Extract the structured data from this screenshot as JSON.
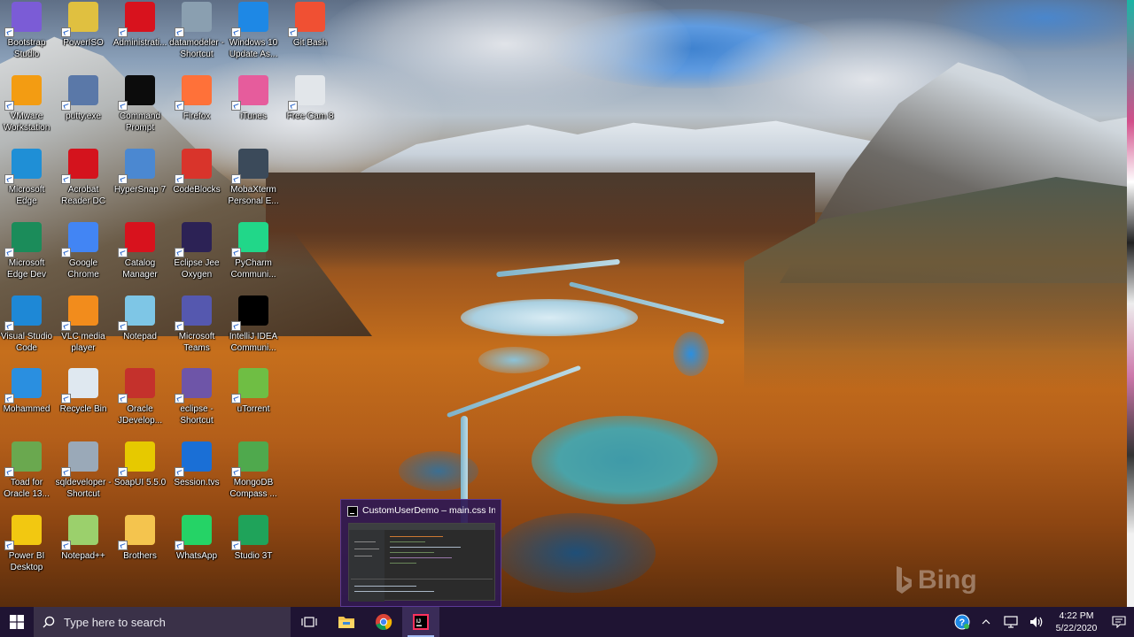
{
  "desktop": {
    "icons": [
      {
        "label": "Bootstrap Studio",
        "icon": "bootstrap-studio-icon",
        "color": "#7b5cd6"
      },
      {
        "label": "PowerISO",
        "icon": "poweriso-icon",
        "color": "#e0c040"
      },
      {
        "label": "Administrati...",
        "icon": "oracle-admin-icon",
        "color": "#d8121d"
      },
      {
        "label": "datamodeler - Shortcut",
        "icon": "datamodeler-icon",
        "color": "#8a9fb0"
      },
      {
        "label": "Windows 10 Update As...",
        "icon": "windows-update-icon",
        "color": "#1e88e5"
      },
      {
        "label": "Git Bash",
        "icon": "git-bash-icon",
        "color": "#f05033"
      },
      {
        "label": "VMware Workstation",
        "icon": "vmware-icon",
        "color": "#f39c12"
      },
      {
        "label": "putty.exe",
        "icon": "putty-icon",
        "color": "#5a78a8"
      },
      {
        "label": "Command Prompt",
        "icon": "command-prompt-icon",
        "color": "#0c0c0c"
      },
      {
        "label": "Firefox",
        "icon": "firefox-icon",
        "color": "#ff7139"
      },
      {
        "label": "iTunes",
        "icon": "itunes-icon",
        "color": "#e65c9c"
      },
      {
        "label": "Free Cam 8",
        "icon": "free-cam-icon",
        "color": "#e2e6ea"
      },
      {
        "label": "Microsoft Edge",
        "icon": "edge-icon",
        "color": "#1f8fd6"
      },
      {
        "label": "Acrobat Reader DC",
        "icon": "acrobat-icon",
        "color": "#d4131d"
      },
      {
        "label": "HyperSnap 7",
        "icon": "hypersnap-icon",
        "color": "#4b88d1"
      },
      {
        "label": "CodeBlocks",
        "icon": "codeblocks-icon",
        "color": "#d9342b"
      },
      {
        "label": "MobaXterm Personal E...",
        "icon": "mobaxterm-icon",
        "color": "#3b4a5a"
      },
      {
        "label": "Microsoft Edge Dev",
        "icon": "edge-dev-icon",
        "color": "#1b8c5a"
      },
      {
        "label": "Google Chrome",
        "icon": "chrome-icon",
        "color": "#4285f4"
      },
      {
        "label": "Catalog Manager",
        "icon": "catalog-manager-icon",
        "color": "#d8121d"
      },
      {
        "label": "Eclipse Jee Oxygen",
        "icon": "eclipse-icon",
        "color": "#2c2255"
      },
      {
        "label": "PyCharm Communi...",
        "icon": "pycharm-icon",
        "color": "#21d789"
      },
      {
        "label": "Visual Studio Code",
        "icon": "vscode-icon",
        "color": "#1e88d6"
      },
      {
        "label": "VLC media player",
        "icon": "vlc-icon",
        "color": "#f28c1c"
      },
      {
        "label": "Notepad",
        "icon": "notepad-icon",
        "color": "#7ec6e6"
      },
      {
        "label": "Microsoft Teams",
        "icon": "teams-icon",
        "color": "#5558af"
      },
      {
        "label": "IntelliJ IDEA Communi...",
        "icon": "intellij-icon",
        "color": "#000000"
      },
      {
        "label": "Mohammed",
        "icon": "user-folder-icon",
        "color": "#2a8fe0"
      },
      {
        "label": "Recycle Bin",
        "icon": "recycle-bin-icon",
        "color": "#dfe8f0"
      },
      {
        "label": "Oracle JDevelop...",
        "icon": "jdeveloper-icon",
        "color": "#c4312c"
      },
      {
        "label": "eclipse - Shortcut",
        "icon": "eclipse-shortcut-icon",
        "color": "#6e55a8"
      },
      {
        "label": "uTorrent",
        "icon": "utorrent-icon",
        "color": "#6fbe44"
      },
      {
        "label": "Toad for Oracle 13...",
        "icon": "toad-icon",
        "color": "#6aa84f"
      },
      {
        "label": "sqldeveloper - Shortcut",
        "icon": "sqldeveloper-icon",
        "color": "#9aa9b8"
      },
      {
        "label": "SoapUI 5.5.0",
        "icon": "soapui-icon",
        "color": "#e6c900"
      },
      {
        "label": "Session.tvs",
        "icon": "teamviewer-icon",
        "color": "#1a6fd6"
      },
      {
        "label": "MongoDB Compass ...",
        "icon": "mongodb-icon",
        "color": "#4fa94d"
      },
      {
        "label": "Power BI Desktop",
        "icon": "powerbi-icon",
        "color": "#f2c811"
      },
      {
        "label": "Notepad++",
        "icon": "notepadpp-icon",
        "color": "#9bd06c"
      },
      {
        "label": "Brothers",
        "icon": "folder-icon",
        "color": "#f4c44e"
      },
      {
        "label": "WhatsApp",
        "icon": "whatsapp-icon",
        "color": "#25d366"
      },
      {
        "label": "Studio 3T",
        "icon": "studio3t-icon",
        "color": "#1fa35a"
      }
    ]
  },
  "thumbnail": {
    "title": "CustomUserDemo – main.css In..."
  },
  "watermark": {
    "text": "Bing"
  },
  "taskbar": {
    "search_placeholder": "Type here to search",
    "time": "4:22 PM",
    "date": "5/22/2020",
    "pinned": [
      {
        "name": "task-view",
        "icon": "task-view-icon"
      },
      {
        "name": "file-explorer",
        "icon": "file-explorer-icon",
        "color": "#f4c44e"
      },
      {
        "name": "chrome",
        "icon": "chrome-icon"
      },
      {
        "name": "intellij",
        "icon": "intellij-icon",
        "active": true
      }
    ]
  }
}
